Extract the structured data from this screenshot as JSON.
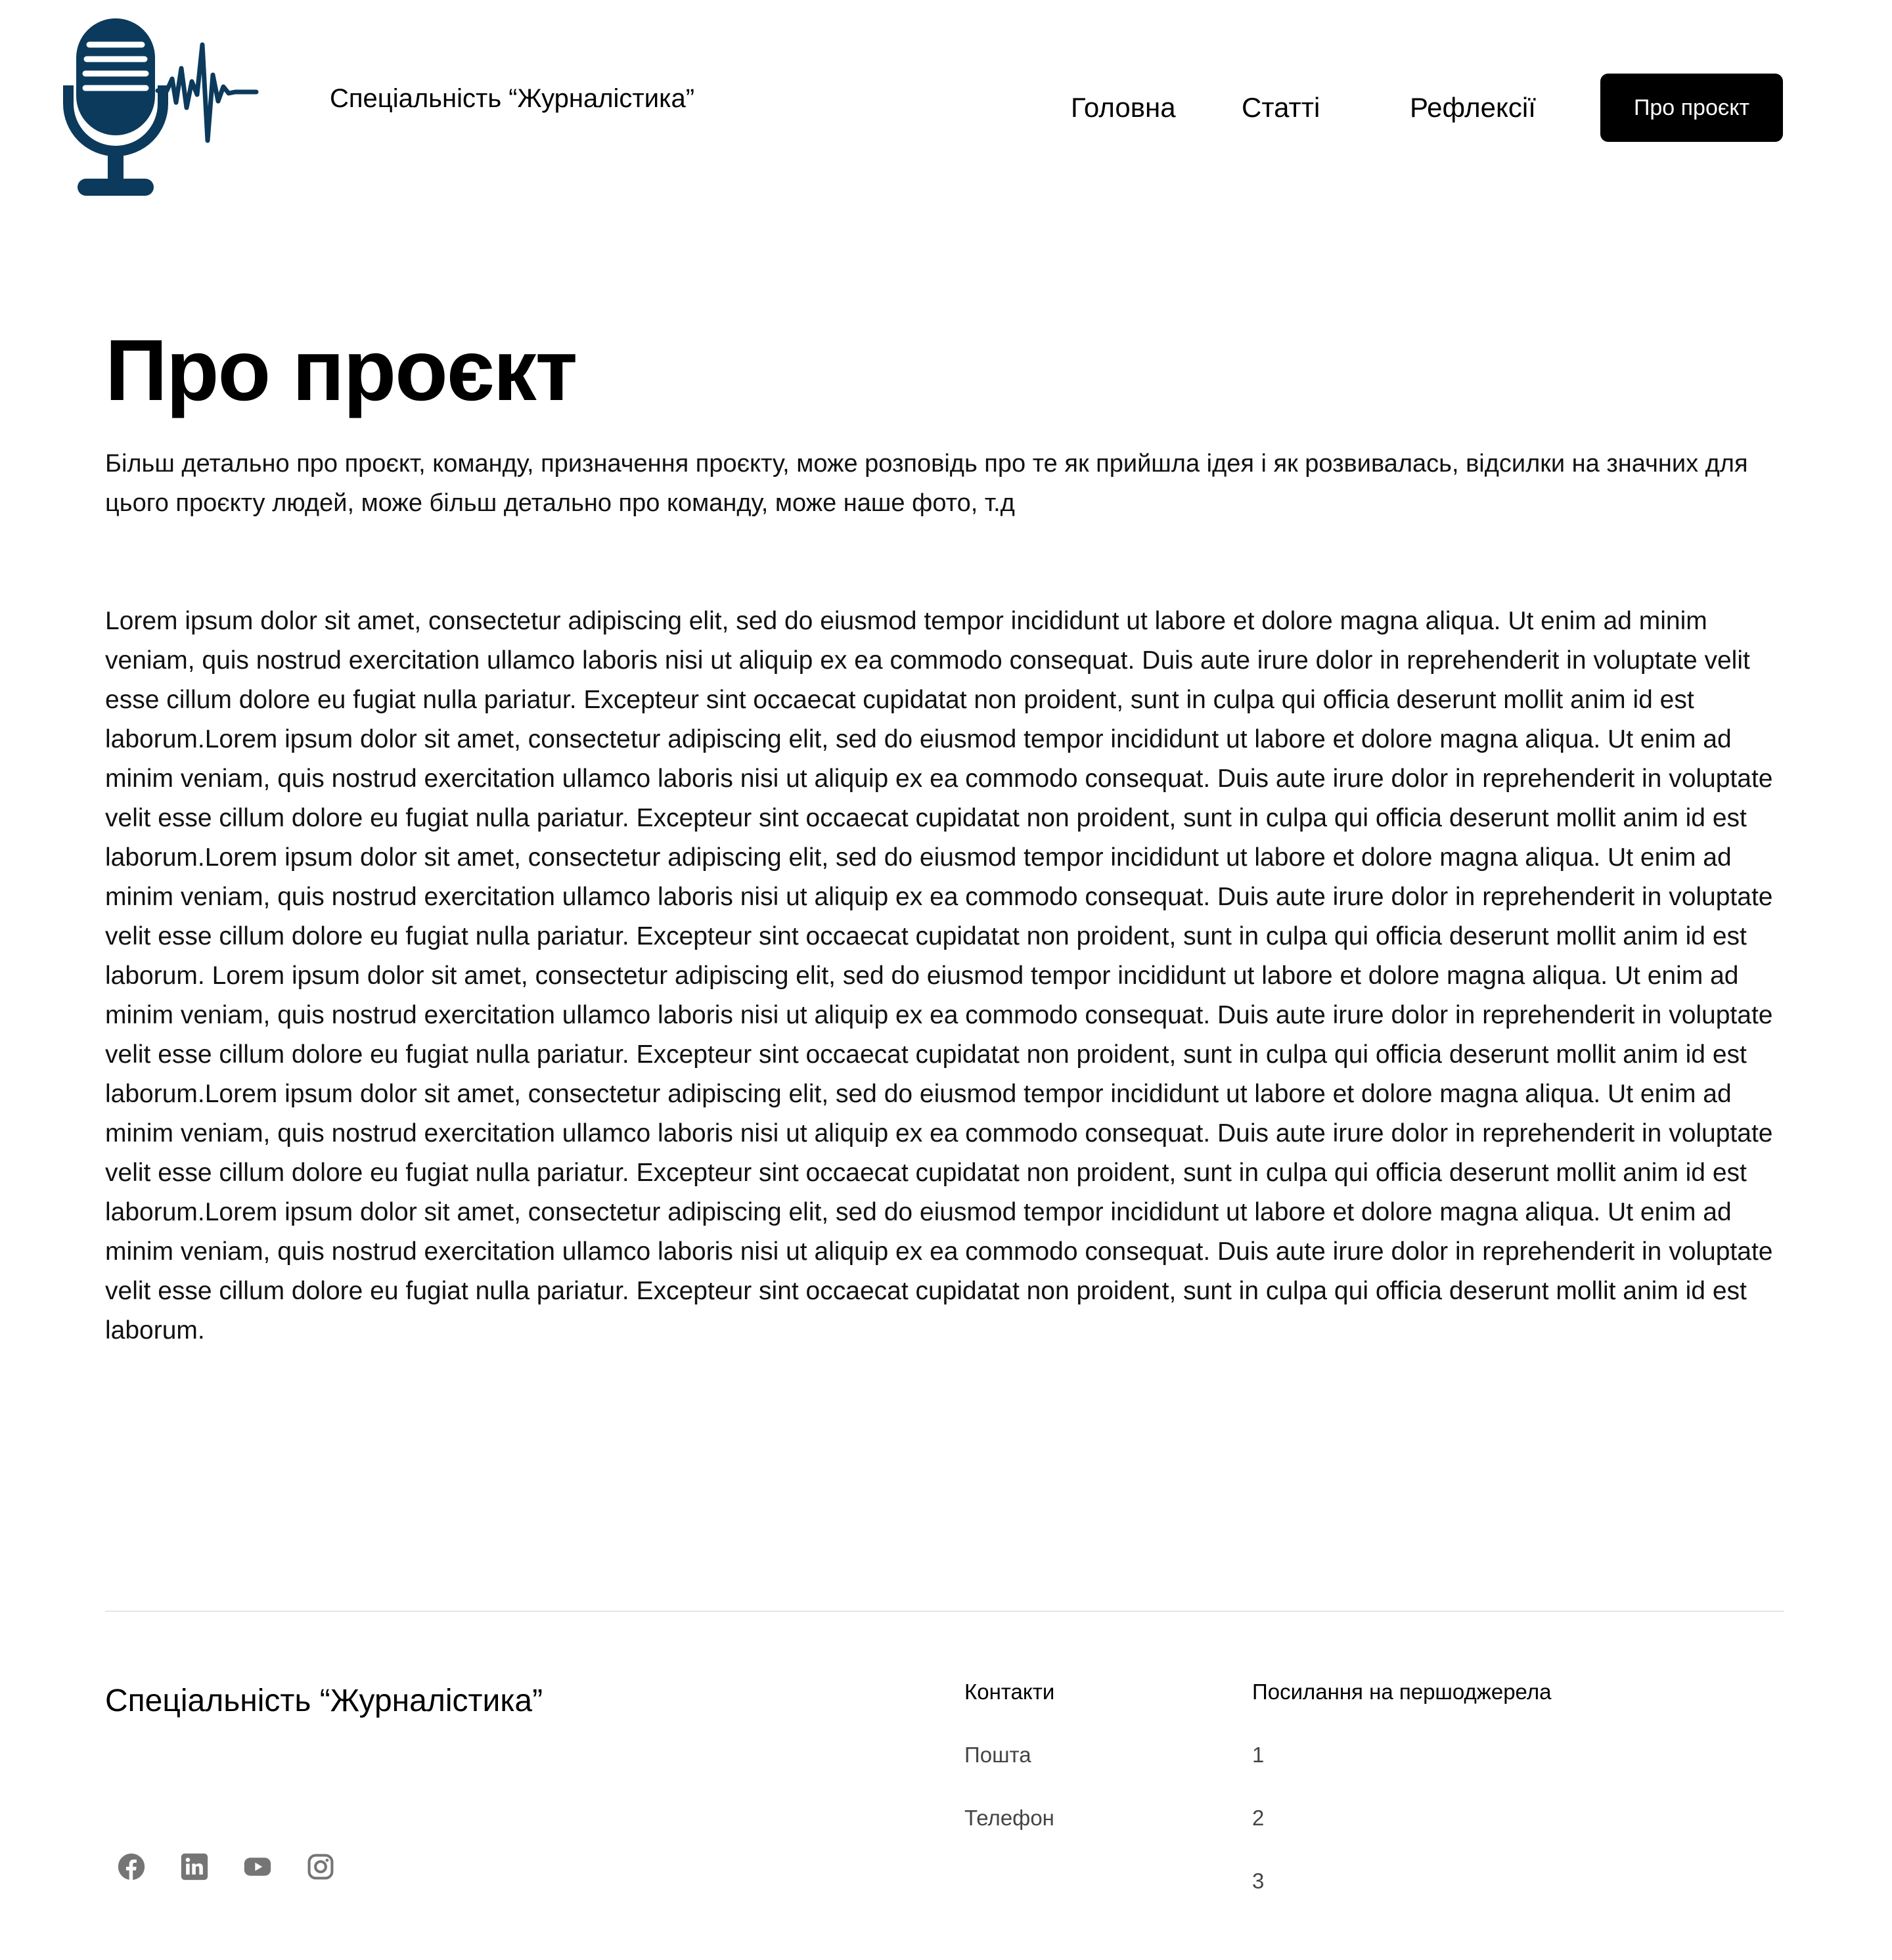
{
  "colors": {
    "logo": "#0b3a5c",
    "cta_background": "#000000",
    "cta_text": "#ffffff",
    "divider": "#e6e6e6",
    "social_icon": "#757575"
  },
  "header": {
    "logo_icon": "microphone-soundwave-icon",
    "site_title": "Спеціальність “Журналістика”",
    "nav": {
      "home": "Головна",
      "articles": "Статті",
      "reflections": "Рефлексії",
      "about": "Про проєкт"
    }
  },
  "main": {
    "title": "Про проєкт",
    "intro": "Більш детально про проєкт, команду, призначення проєкту, може розповідь про те як прийшла ідея і як розвивалась, відсилки на значних для цього проєкту людей, може більш детально про команду, може наше фото, т.д",
    "body": "Lorem ipsum dolor sit amet, consectetur adipiscing elit, sed do eiusmod tempor incididunt ut labore et dolore magna aliqua. Ut enim ad minim veniam, quis nostrud exercitation ullamco laboris nisi ut aliquip ex ea commodo consequat. Duis aute irure dolor in reprehenderit in voluptate velit esse cillum dolore eu fugiat nulla pariatur. Excepteur sint occaecat cupidatat non proident, sunt in culpa qui officia deserunt mollit anim id est laborum.Lorem ipsum dolor sit amet, consectetur adipiscing elit, sed do eiusmod tempor incididunt ut labore et dolore magna aliqua. Ut enim ad minim veniam, quis nostrud exercitation ullamco laboris nisi ut aliquip ex ea commodo consequat. Duis aute irure dolor in reprehenderit in voluptate velit esse cillum dolore eu fugiat nulla pariatur. Excepteur sint occaecat cupidatat non proident, sunt in culpa qui officia deserunt mollit anim id est laborum.Lorem ipsum dolor sit amet, consectetur adipiscing elit, sed do eiusmod tempor incididunt ut labore et dolore magna aliqua. Ut enim ad minim veniam, quis nostrud exercitation ullamco laboris nisi ut aliquip ex ea commodo consequat. Duis aute irure dolor in reprehenderit in voluptate velit esse cillum dolore eu fugiat nulla pariatur. Excepteur sint occaecat cupidatat non proident, sunt in culpa qui officia deserunt mollit anim id est laborum. Lorem ipsum dolor sit amet, consectetur adipiscing elit, sed do eiusmod tempor incididunt ut labore et dolore magna aliqua. Ut enim ad minim veniam, quis nostrud exercitation ullamco laboris nisi ut aliquip ex ea commodo consequat. Duis aute irure dolor in reprehenderit in voluptate velit esse cillum dolore eu fugiat nulla pariatur. Excepteur sint occaecat cupidatat non proident, sunt in culpa qui officia deserunt mollit anim id est laborum.Lorem ipsum dolor sit amet, consectetur adipiscing elit, sed do eiusmod tempor incididunt ut labore et dolore magna aliqua. Ut enim ad minim veniam, quis nostrud exercitation ullamco laboris nisi ut aliquip ex ea commodo consequat. Duis aute irure dolor in reprehenderit in voluptate velit esse cillum dolore eu fugiat nulla pariatur. Excepteur sint occaecat cupidatat non proident, sunt in culpa qui officia deserunt mollit anim id est laborum.Lorem ipsum dolor sit amet, consectetur adipiscing elit, sed do eiusmod tempor incididunt ut labore et dolore magna aliqua. Ut enim ad minim veniam, quis nostrud exercitation ullamco laboris nisi ut aliquip ex ea commodo consequat. Duis aute irure dolor in reprehenderit in voluptate velit esse cillum dolore eu fugiat nulla pariatur. Excepteur sint occaecat cupidatat non proident, sunt in culpa qui officia deserunt mollit anim id est laborum."
  },
  "footer": {
    "title": "Спеціальність “Журналістика”",
    "socials": [
      "facebook-icon",
      "linkedin-icon",
      "youtube-icon",
      "instagram-icon"
    ],
    "contacts": {
      "title": "Контакти",
      "items": [
        "Пошта",
        "Телефон"
      ]
    },
    "sources": {
      "title": "Посилання на першоджерела",
      "items": [
        "1",
        "2",
        "3"
      ]
    }
  }
}
